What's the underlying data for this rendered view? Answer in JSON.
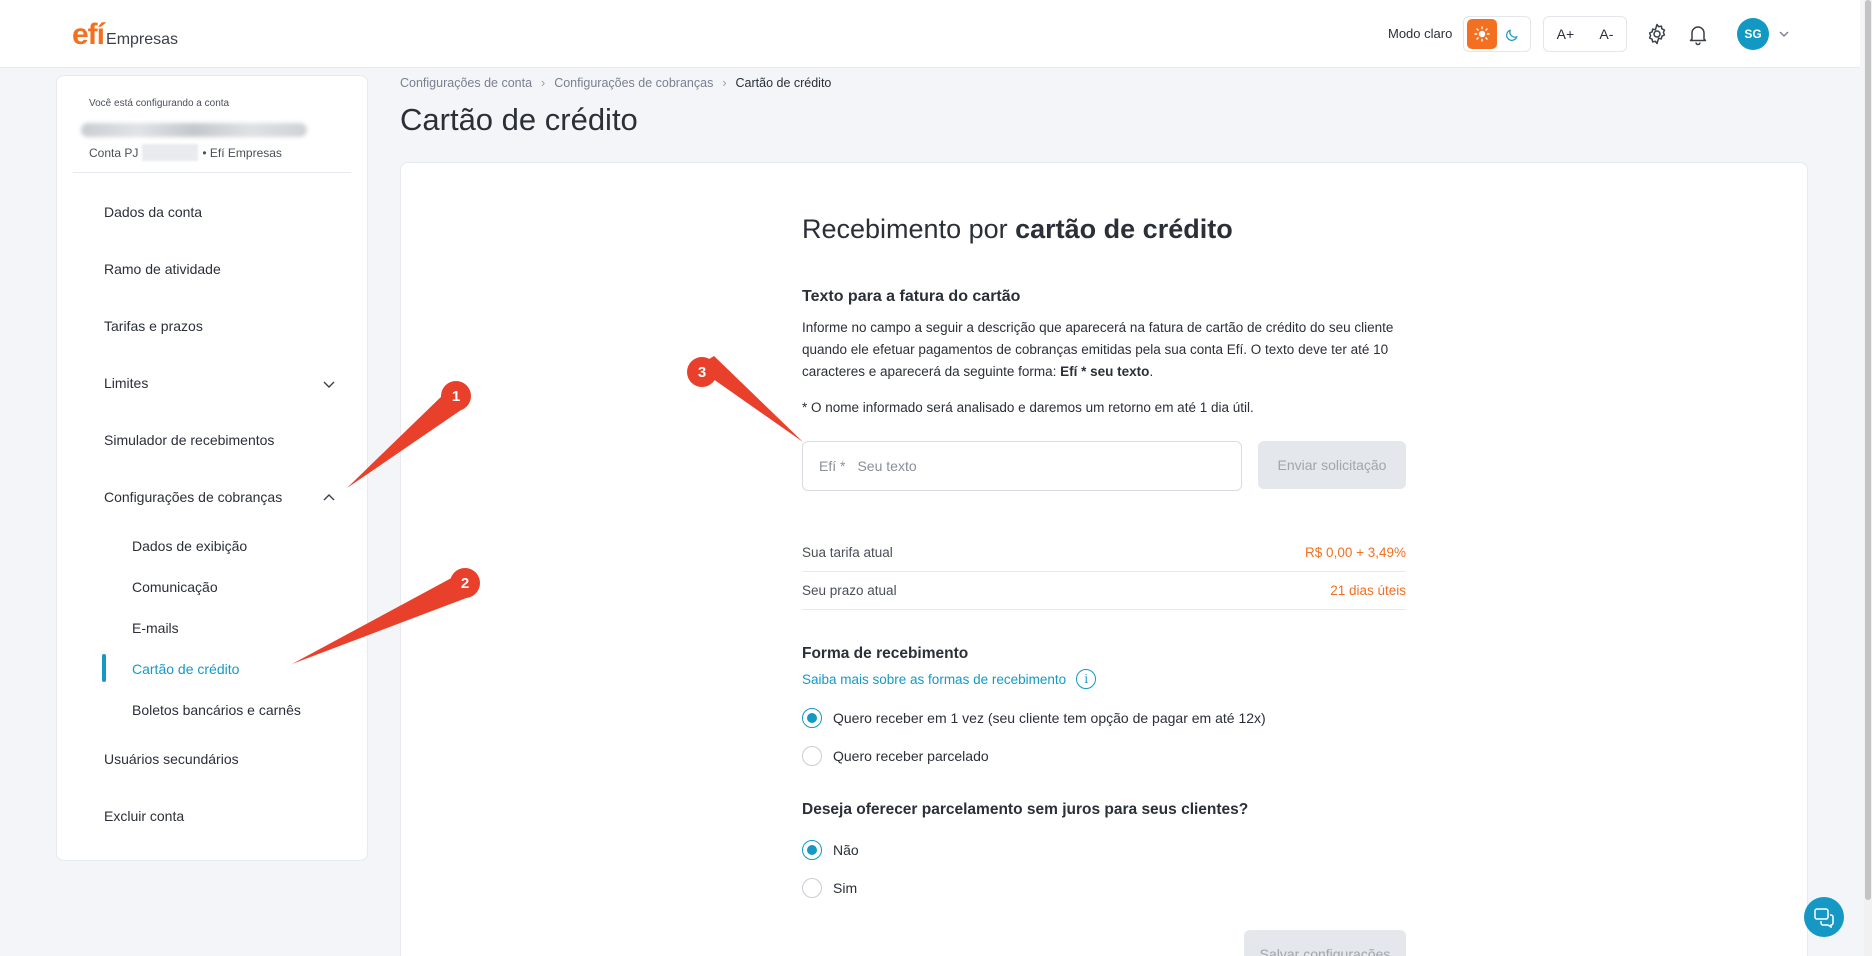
{
  "header": {
    "logo_mark": "efí",
    "logo_text": "Empresas",
    "mode_label": "Modo claro",
    "font_increase": "A+",
    "font_decrease": "A-",
    "avatar_initials": "SG",
    "icons": [
      "sun-icon",
      "moon-icon",
      "gear-icon",
      "bell-icon",
      "chevron-down-icon"
    ],
    "accent_color": "#f37021"
  },
  "sidebar": {
    "account_caption": "Você está configurando a conta",
    "account_type": "Conta PJ",
    "account_suffix": "• Efí Empresas",
    "items": [
      {
        "label": "Dados da conta"
      },
      {
        "label": "Ramo de atividade"
      },
      {
        "label": "Tarifas e prazos"
      },
      {
        "label": "Limites"
      },
      {
        "label": "Simulador de recebimentos"
      },
      {
        "label": "Configurações de cobranças"
      },
      {
        "label": "Usuários secundários"
      },
      {
        "label": "Excluir conta"
      }
    ],
    "subitems": [
      {
        "label": "Dados de exibição"
      },
      {
        "label": "Comunicação"
      },
      {
        "label": "E-mails"
      },
      {
        "label": "Cartão de crédito"
      },
      {
        "label": "Boletos bancários e carnês"
      }
    ],
    "active_color": "#1599c4"
  },
  "breadcrumb": [
    "Configurações de conta",
    "Configurações de cobranças",
    "Cartão de crédito"
  ],
  "page_title": "Cartão de crédito",
  "section": {
    "title_prefix": "Recebimento por ",
    "title_bold": "cartão de crédito",
    "invoice_heading": "Texto para a fatura do cartão",
    "description": "Informe no campo a seguir a descrição que aparecerá na fatura de cartão de crédito do seu cliente quando ele efetuar pagamentos de cobranças emitidas pela sua conta Efí. O texto deve ter até 10 caracteres e aparecerá da seguinte forma: ",
    "description_bold": "Efí * seu texto",
    "description_end": ".",
    "note": "* O nome informado será analisado e daremos um retorno em até 1 dia útil.",
    "input_prefix": "Efí *",
    "input_placeholder": "Seu texto",
    "submit_label": "Enviar solicitação",
    "tariff_label": "Sua tarifa atual",
    "tariff_value": "R$ 0,00 + 3,49%",
    "term_label": "Seu prazo atual",
    "term_value": "21 dias úteis",
    "receive_heading": "Forma de recebimento",
    "receive_link": "Saiba mais sobre as formas de recebimento",
    "receive_options": [
      {
        "label": "Quero receber em 1 vez (seu cliente tem opção de pagar em até 12x)",
        "checked": true
      },
      {
        "label": "Quero receber parcelado",
        "checked": false
      }
    ],
    "installment_heading": "Deseja oferecer parcelamento sem juros para seus clientes?",
    "installment_options": [
      {
        "label": "Não",
        "checked": true
      },
      {
        "label": "Sim",
        "checked": false
      }
    ],
    "save_label": "Salvar configurações"
  },
  "annotations": [
    "1",
    "2",
    "3"
  ]
}
